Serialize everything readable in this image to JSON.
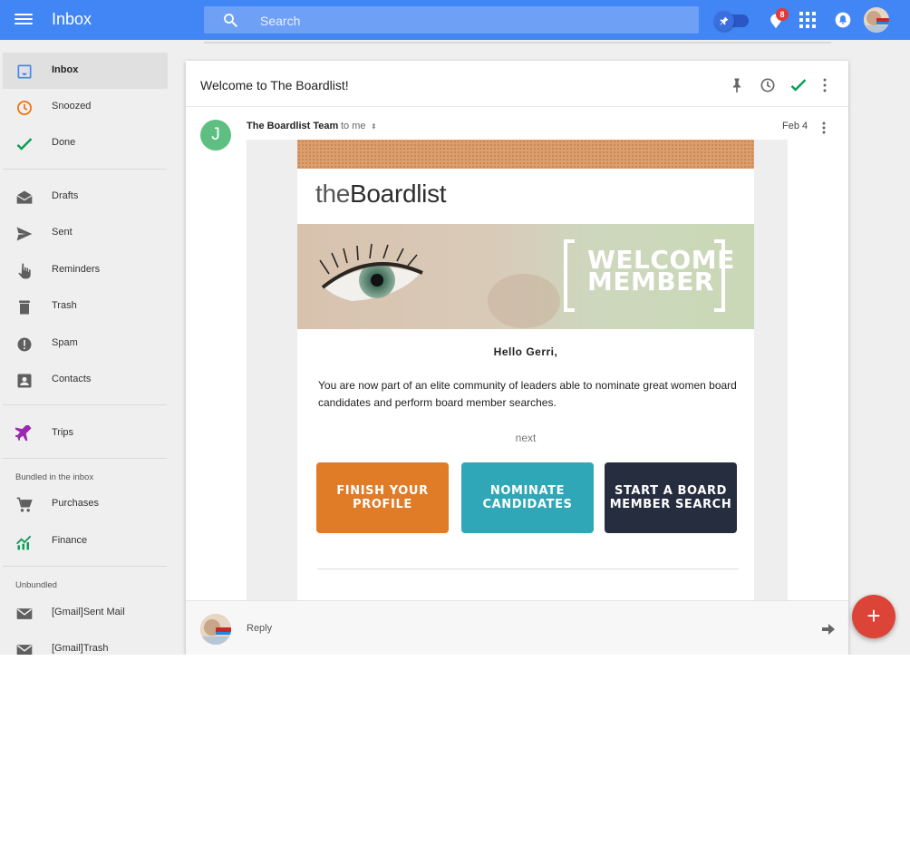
{
  "app": {
    "title": "Inbox"
  },
  "search": {
    "placeholder": "Search"
  },
  "header": {
    "notification_count": "8"
  },
  "sidebar": {
    "items": [
      {
        "label": "Inbox",
        "icon": "inbox-icon",
        "active": true
      },
      {
        "label": "Snoozed",
        "icon": "clock-icon",
        "color": "#ef6c00"
      },
      {
        "label": "Done",
        "icon": "check-icon",
        "color": "#0f9d58"
      },
      {
        "label": "Drafts",
        "icon": "drafts-icon"
      },
      {
        "label": "Sent",
        "icon": "send-icon"
      },
      {
        "label": "Reminders",
        "icon": "reminder-hand-icon"
      },
      {
        "label": "Trash",
        "icon": "trash-icon"
      },
      {
        "label": "Spam",
        "icon": "spam-icon"
      },
      {
        "label": "Contacts",
        "icon": "contacts-icon"
      },
      {
        "label": "Trips",
        "icon": "plane-icon",
        "color": "#9c27b0"
      }
    ],
    "bundled_label": "Bundled in the inbox",
    "bundled": [
      {
        "label": "Purchases",
        "icon": "cart-icon"
      },
      {
        "label": "Finance",
        "icon": "finance-chart-icon",
        "color": "#0f9d58"
      }
    ],
    "unbundled_label": "Unbundled",
    "unbundled": [
      {
        "label": "[Gmail]Sent Mail",
        "icon": "mail-icon"
      },
      {
        "label": "[Gmail]Trash",
        "icon": "mail-icon"
      }
    ]
  },
  "conversation": {
    "subject": "Welcome to The Boardlist!",
    "sender": {
      "initial": "J",
      "name": "The Boardlist Team",
      "to": "to me",
      "date": "Feb 4"
    },
    "email": {
      "logo_light": "the",
      "logo_bold": "Boardlist",
      "hero_line1": "WELCOME",
      "hero_line2": "MEMBER",
      "greeting": "Hello Gerri,",
      "body": "You are now part of an elite community of leaders able to nominate great women board candidates and perform board member searches.",
      "next_label": "next",
      "buttons": [
        {
          "line1": "FINISH YOUR",
          "line2": "PROFILE",
          "color": "#e07b27"
        },
        {
          "line1": "NOMINATE",
          "line2": "CANDIDATES",
          "color": "#30a7b6"
        },
        {
          "line1": "START A BOARD",
          "line2": "MEMBER SEARCH",
          "color": "#262d3f"
        }
      ]
    },
    "reply_label": "Reply"
  },
  "colors": {
    "topbar": "#4285f4",
    "fab": "#db4437",
    "sender_avatar": "#5fbf82"
  }
}
